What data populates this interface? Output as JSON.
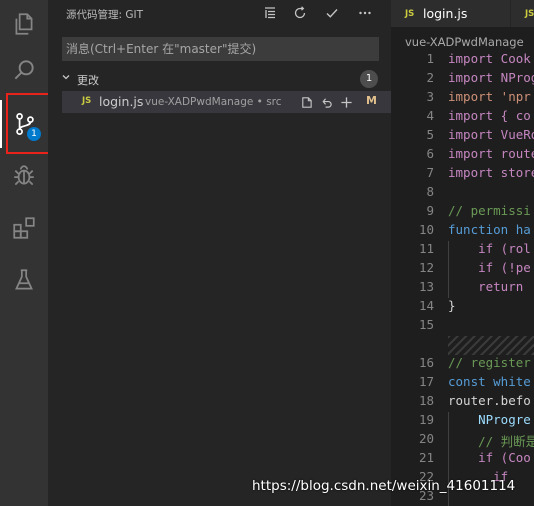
{
  "activity_bar": {
    "scm_badge": "1",
    "highlight_color": "#e8231c",
    "icons": [
      "files-icon",
      "search-icon",
      "source-control-icon",
      "debug-icon",
      "extensions-icon",
      "testing-icon"
    ]
  },
  "scm": {
    "title": "源代码管理: GIT",
    "commit_placeholder": "消息(Ctrl+Enter 在\"master\"提交)",
    "changes_label": "更改",
    "changes_count": "1",
    "files": [
      {
        "type": "JS",
        "name": "login.js",
        "description": "vue-XADPwdManage • src",
        "status": "M"
      }
    ]
  },
  "editor": {
    "tabs": [
      {
        "type": "JS",
        "name": "login.js"
      },
      {
        "type": "JS",
        "name": ""
      }
    ],
    "breadcrumb": "vue-XADPwdManage",
    "lines": [
      {
        "n": "1",
        "text": "import Cook"
      },
      {
        "n": "2",
        "text": "import NProg"
      },
      {
        "n": "3",
        "text": "import 'npr"
      },
      {
        "n": "4",
        "text": "import { co"
      },
      {
        "n": "5",
        "text": "import VueRo"
      },
      {
        "n": "6",
        "text": "import route"
      },
      {
        "n": "7",
        "text": "import store"
      },
      {
        "n": "8",
        "text": ""
      },
      {
        "n": "9",
        "text": "// permissi"
      },
      {
        "n": "10",
        "text": "function ha"
      },
      {
        "n": "11",
        "text": "    if (rol"
      },
      {
        "n": "12",
        "text": "    if (!pe"
      },
      {
        "n": "13",
        "text": "    return "
      },
      {
        "n": "14",
        "text": "}"
      },
      {
        "n": "15",
        "text": ""
      },
      {
        "n": "16",
        "text": "// register"
      },
      {
        "n": "17",
        "text": "const white"
      },
      {
        "n": "18",
        "text": "router.befo"
      },
      {
        "n": "19",
        "text": "    NProgre"
      },
      {
        "n": "20",
        "text": "    // 判断是"
      },
      {
        "n": "21",
        "text": "    if (Coo"
      },
      {
        "n": "22",
        "text": "      if"
      },
      {
        "n": "23",
        "text": ""
      }
    ]
  },
  "watermark": "https://blog.csdn.net/weixin_41601114"
}
